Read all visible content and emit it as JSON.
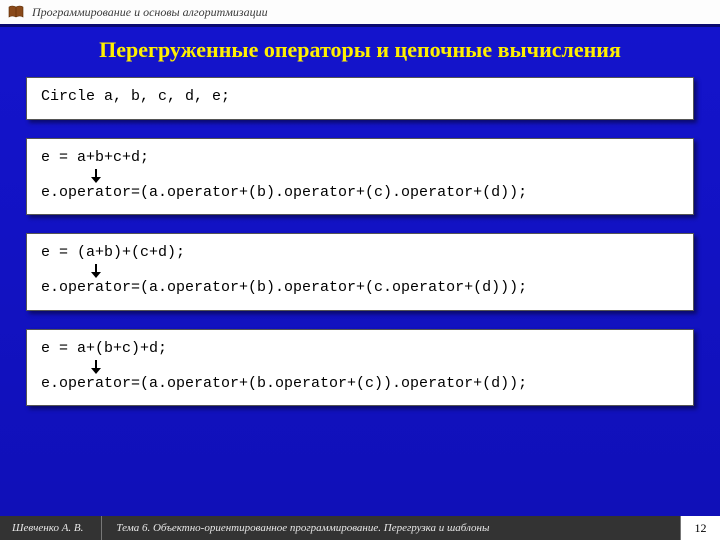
{
  "header": {
    "course_title": "Программирование и основы алгоритмизации"
  },
  "slide": {
    "heading": "Перегруженные операторы и цепочные вычисления"
  },
  "code_blocks": [
    {
      "lines": [
        "Circle a, b, c, d, e;"
      ]
    },
    {
      "lines": [
        "e = a+b+c+d;",
        "e.operator=(a.operator+(b).operator+(c).operator+(d));"
      ]
    },
    {
      "lines": [
        "e = (a+b)+(c+d);",
        "e.operator=(a.operator+(b).operator+(c.operator+(d)));"
      ]
    },
    {
      "lines": [
        "e = a+(b+c)+d;",
        "e.operator=(a.operator+(b.operator+(c)).operator+(d));"
      ]
    }
  ],
  "footer": {
    "author": "Шевченко А. В.",
    "topic": "Тема 6. Объектно-ориентированное программирование. Перегрузка и шаблоны",
    "page": "12"
  }
}
